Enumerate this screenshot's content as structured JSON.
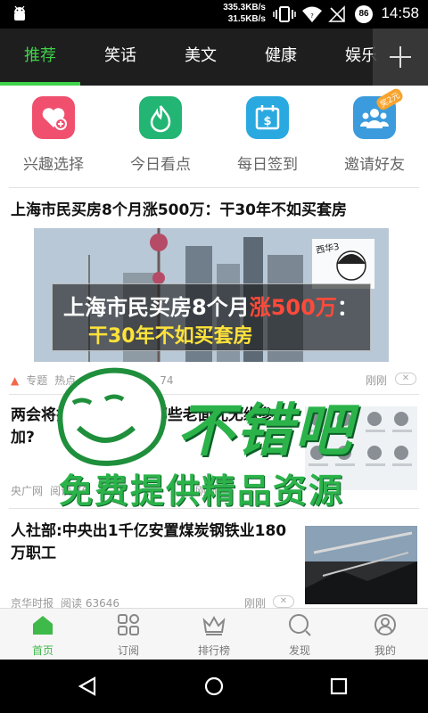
{
  "status": {
    "speed_up": "335.3KB/s",
    "speed_down": "31.5KB/s",
    "battery_badge": "86",
    "time": "14:58"
  },
  "tabs": [
    {
      "label": "推荐",
      "active": true
    },
    {
      "label": "笑话"
    },
    {
      "label": "美文"
    },
    {
      "label": "健康"
    },
    {
      "label": "娱乐"
    }
  ],
  "quick_actions": [
    {
      "label": "兴趣选择",
      "icon": "heart-plus-icon",
      "color": "#f0506e"
    },
    {
      "label": "今日看点",
      "icon": "flame-icon",
      "color": "#22b573"
    },
    {
      "label": "每日签到",
      "icon": "calendar-dollar-icon",
      "color": "#2aa9e0"
    },
    {
      "label": "邀请好友",
      "icon": "people-icon",
      "color": "#3b9bdc",
      "badge": "奖2元"
    }
  ],
  "articles": [
    {
      "title": "上海市民买房8个月涨500万：干30年不如买套房",
      "image_caption_line1_a": "上海市民买房8个月",
      "image_caption_line1_b": "涨500万",
      "image_caption_line1_c": "：",
      "image_caption_line2": "干30年不如买套房",
      "sticker_text": "西华3",
      "tag": "专题",
      "hot_label": "热点",
      "count": "74",
      "time": "刚刚"
    },
    {
      "title": "两会将拉开帷幕 今年哪些老面孔无缘参加?",
      "source": "央广网",
      "reads": "阅读 76",
      "time": "刚刚"
    },
    {
      "title": "人社部:中央出1千亿安置煤炭钢铁业180万职工",
      "source": "京华时报",
      "reads": "阅读 63646",
      "time": "刚刚"
    }
  ],
  "close_glyph": "✕",
  "watermark": {
    "big": "不错吧",
    "small": "免费提供精品资源"
  },
  "bottom_nav": [
    {
      "label": "首页",
      "icon": "home-icon",
      "active": true
    },
    {
      "label": "订阅",
      "icon": "grid-icon"
    },
    {
      "label": "排行榜",
      "icon": "crown-icon"
    },
    {
      "label": "发现",
      "icon": "discover-icon"
    },
    {
      "label": "我的",
      "icon": "profile-icon"
    }
  ],
  "colors": {
    "accent": "#3fd24a",
    "tabbar_bg": "#1e1e1e"
  }
}
